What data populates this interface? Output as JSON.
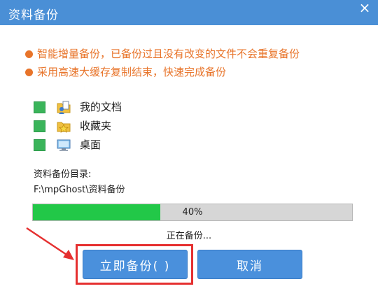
{
  "window": {
    "title": "资料备份"
  },
  "tips": [
    {
      "text": "智能增量备份，已备份过且没有改变的文件不会重复备份"
    },
    {
      "text": "采用高速大缓存复制结束，快速完成备份"
    }
  ],
  "items": [
    {
      "label": "我的文档",
      "checked": true,
      "icon": "documents-folder-icon"
    },
    {
      "label": "收藏夹",
      "checked": true,
      "icon": "favorites-folder-icon"
    },
    {
      "label": "桌面",
      "checked": true,
      "icon": "desktop-icon"
    }
  ],
  "backup": {
    "dir_label": "资料备份目录:",
    "dir_path": "F:\\mpGhost\\资料备份",
    "progress_percent": 40,
    "progress_text": "40%",
    "status": "正在备份..."
  },
  "buttons": {
    "start_label": "立即备份(  )",
    "cancel_label": "取消"
  },
  "colors": {
    "titlebar": "#4a8fd6",
    "tip": "#e8742a",
    "progress_fill": "#22c848",
    "button": "#4a90dc",
    "highlight": "#e53030"
  }
}
